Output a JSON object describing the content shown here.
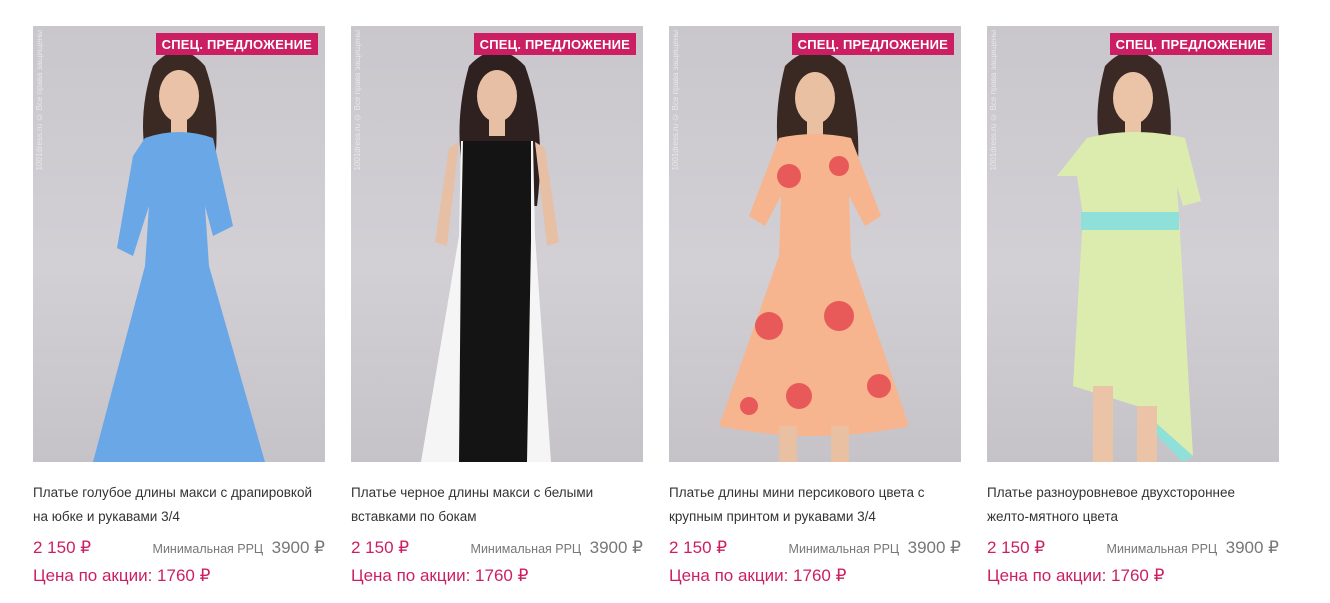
{
  "products": [
    {
      "badge": "СПЕЦ. ПРЕДЛОЖЕНИЕ",
      "watermark": "1001dress.ru © Все права защищены",
      "title": "Платье голубое длины макси с драпировкой на юбке и рукавами 3/4",
      "price": "2 150 ₽",
      "rrc_label": "Минимальная РРЦ",
      "rrc_value": "3900 ₽",
      "promo": "Цена по акции: 1760 ₽",
      "dress_color": "#6aa7e6",
      "accent_color": "#6aa7e6"
    },
    {
      "badge": "СПЕЦ. ПРЕДЛОЖЕНИЕ",
      "watermark": "1001dress.ru © Все права защищены",
      "title": "Платье черное длины макси с белыми вставками по бокам",
      "price": "2 150 ₽",
      "rrc_label": "Минимальная РРЦ",
      "rrc_value": "3900 ₽",
      "promo": "Цена по акции: 1760 ₽",
      "dress_color": "#141414",
      "accent_color": "#f5f5f5"
    },
    {
      "badge": "СПЕЦ. ПРЕДЛОЖЕНИЕ",
      "watermark": "1001dress.ru © Все права защищены",
      "title": "Платье длины мини персикового цвета с крупным принтом и рукавами 3/4",
      "price": "2 150 ₽",
      "rrc_label": "Минимальная РРЦ",
      "rrc_value": "3900 ₽",
      "promo": "Цена по акции: 1760 ₽",
      "dress_color": "#f6b58e",
      "accent_color": "#e85a5a"
    },
    {
      "badge": "СПЕЦ. ПРЕДЛОЖЕНИЕ",
      "watermark": "1001dress.ru © Все права защищены",
      "title": "Платье разноуровневое двухстороннее желто-мятного цвета",
      "price": "2 150 ₽",
      "rrc_label": "Минимальная РРЦ",
      "rrc_value": "3900 ₽",
      "promo": "Цена по акции: 1760 ₽",
      "dress_color": "#dcecae",
      "accent_color": "#8fe0d8"
    }
  ],
  "colors": {
    "brand": "#cc1f63",
    "muted": "#777777",
    "text": "#333333"
  }
}
